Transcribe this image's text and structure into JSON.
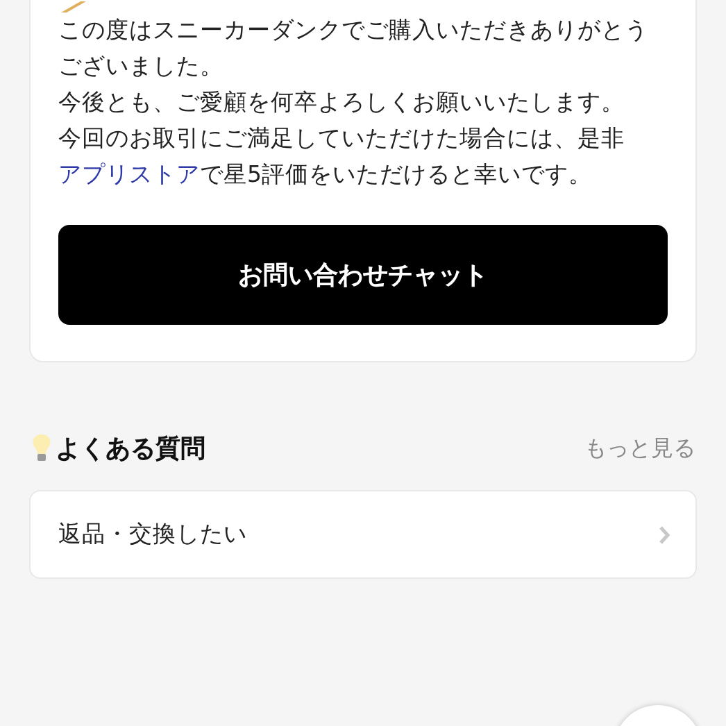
{
  "message_card": {
    "paragraphs": [
      "この度はスニーカーダンクでご購入いただきありがとうございました。",
      "今後とも、ご愛顧を何卒よろしくお願いいたします。"
    ],
    "review_note": {
      "before": "今回のお取引にご満足していただけた場合には、是非",
      "link": "アプリストア",
      "after": "で星5評価をいただけると幸いです。"
    },
    "button": "お問い合わせチャット"
  },
  "faq": {
    "title": "よくある質問",
    "more": "もっと見る",
    "items": [
      {
        "label": "返品・交換したい"
      }
    ]
  }
}
